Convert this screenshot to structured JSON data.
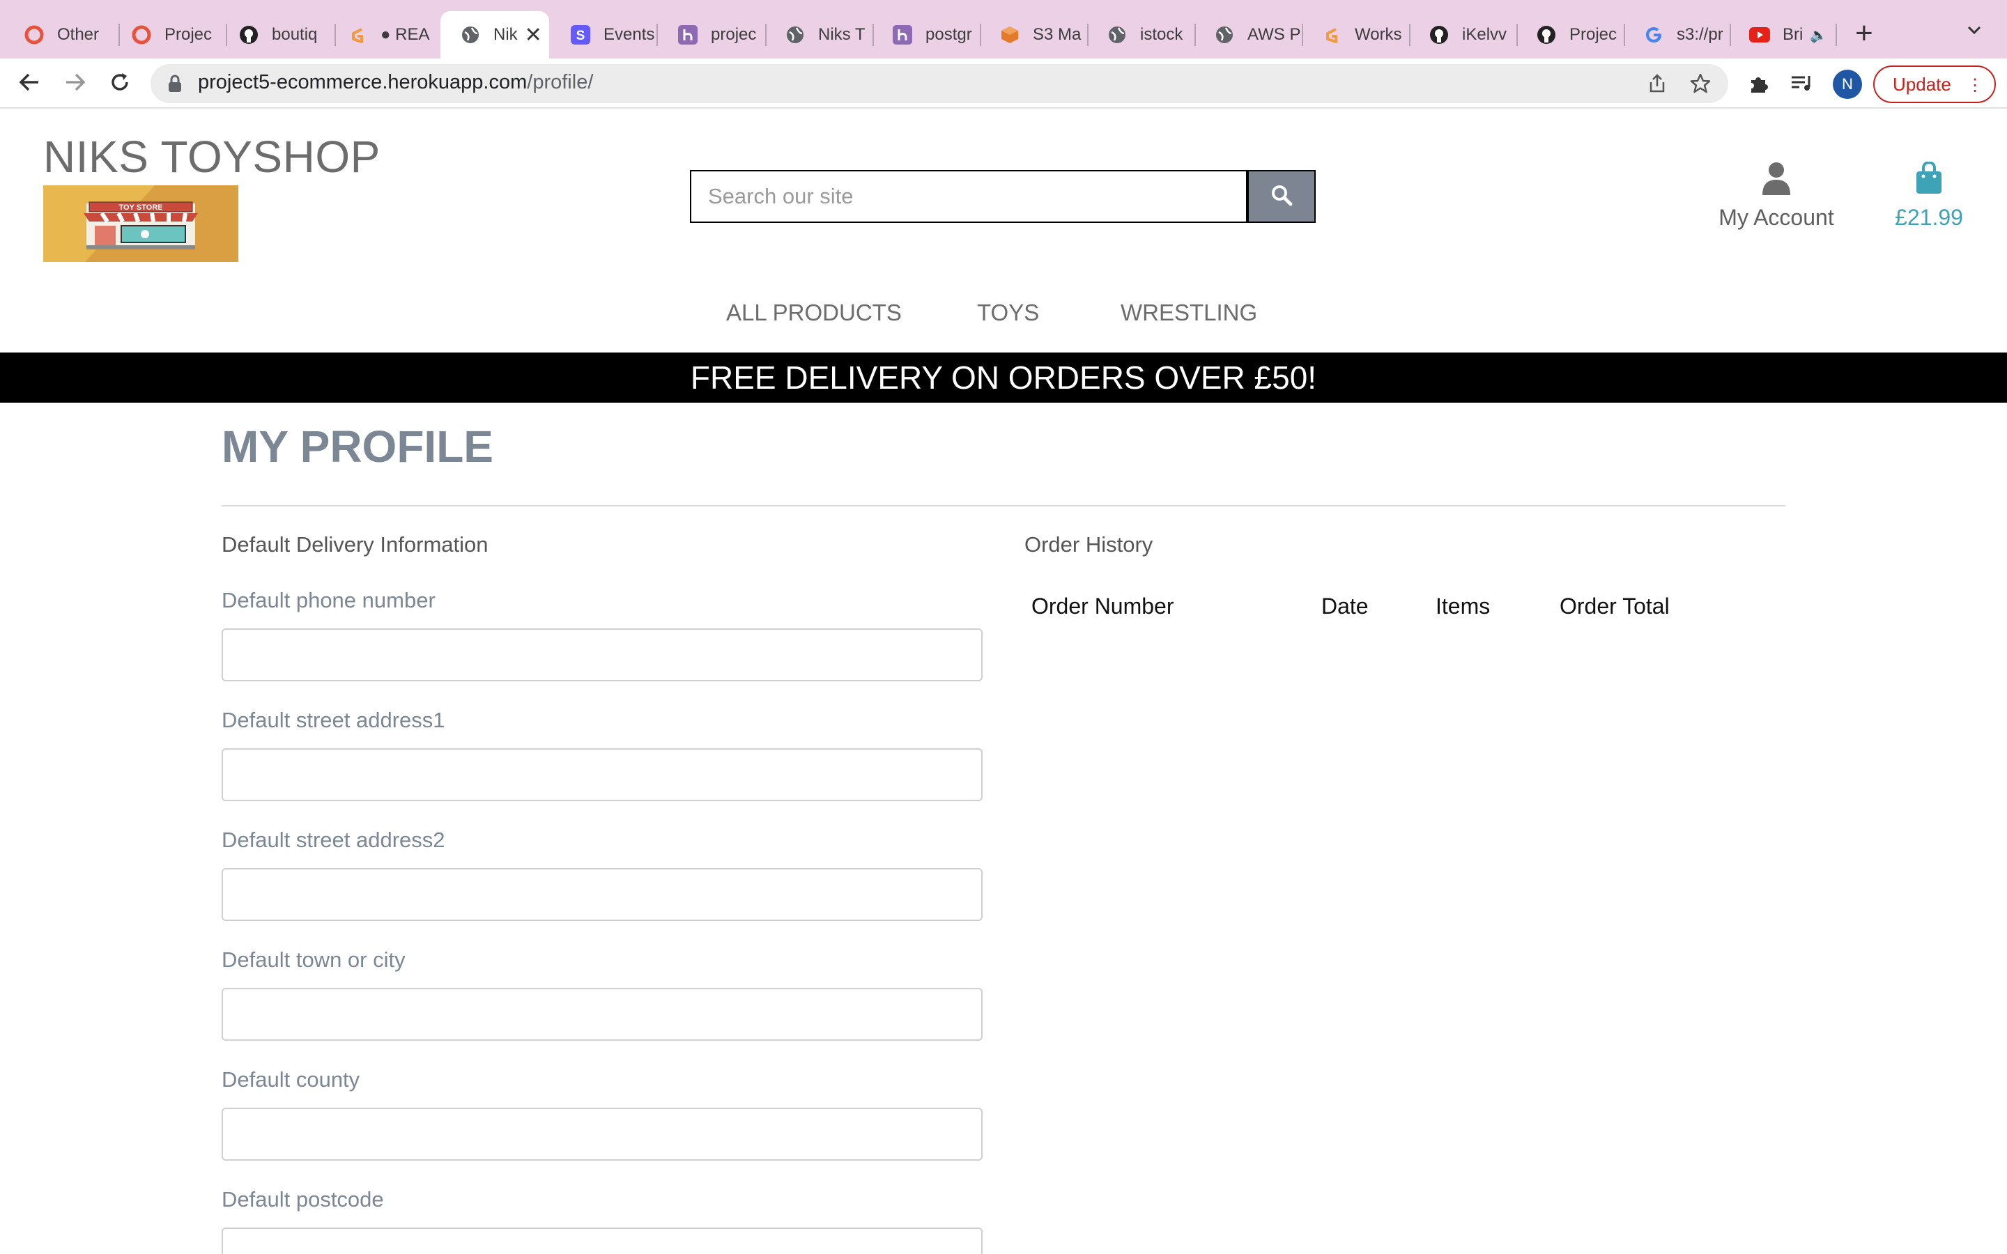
{
  "browser": {
    "tabs": [
      {
        "label": "Other",
        "icon": "opera-icon",
        "active": false
      },
      {
        "label": "Projec",
        "icon": "opera-icon",
        "active": false
      },
      {
        "label": "boutiq",
        "icon": "github-icon",
        "active": false
      },
      {
        "label": "● REA",
        "icon": "gitpod-icon",
        "active": false
      },
      {
        "label": "Nik",
        "icon": "globe-icon",
        "active": true
      },
      {
        "label": "Events",
        "icon": "stripe-icon",
        "active": false
      },
      {
        "label": "projec",
        "icon": "heroku-icon",
        "active": false
      },
      {
        "label": "Niks T",
        "icon": "globe-icon",
        "active": false
      },
      {
        "label": "postgr",
        "icon": "heroku-icon",
        "active": false
      },
      {
        "label": "S3 Ma",
        "icon": "aws-s3-icon",
        "active": false
      },
      {
        "label": "istock",
        "icon": "globe-icon",
        "active": false
      },
      {
        "label": "AWS P",
        "icon": "globe-icon",
        "active": false
      },
      {
        "label": "Works",
        "icon": "gitpod-icon",
        "active": false
      },
      {
        "label": "iKelvv",
        "icon": "github-icon",
        "active": false
      },
      {
        "label": "Projec",
        "icon": "github-icon",
        "active": false
      },
      {
        "label": "s3://pr",
        "icon": "google-icon",
        "active": false
      },
      {
        "label": "Bri",
        "icon": "youtube-icon",
        "active": false
      }
    ],
    "url_host": "project5-ecommerce.herokuapp.com",
    "url_path": "/profile/",
    "profile_initial": "N",
    "update_label": "Update"
  },
  "site": {
    "brand": "NIKS TOYSHOP",
    "logo_text": "TOY STORE",
    "search_placeholder": "Search our site",
    "account_label": "My Account",
    "bag_total": "£21.99",
    "nav": [
      "ALL PRODUCTS",
      "TOYS",
      "WRESTLING"
    ],
    "banner": "FREE DELIVERY ON ORDERS OVER £50!"
  },
  "profile": {
    "title": "MY PROFILE",
    "delivery_heading": "Default Delivery Information",
    "fields": [
      {
        "label": "Default phone number",
        "value": ""
      },
      {
        "label": "Default street address1",
        "value": ""
      },
      {
        "label": "Default street address2",
        "value": ""
      },
      {
        "label": "Default town or city",
        "value": ""
      },
      {
        "label": "Default county",
        "value": ""
      },
      {
        "label": "Default postcode",
        "value": ""
      }
    ],
    "order_history_heading": "Order History",
    "order_columns": [
      "Order Number",
      "Date",
      "Items",
      "Order Total"
    ]
  },
  "colors": {
    "tabstrip": "#ecd1e6",
    "brand_grey": "#6c6c6c",
    "heading_slate": "#7c8796",
    "bag_teal": "#3ea3b6",
    "search_button": "#7d8592",
    "update_red": "#c5221f"
  }
}
